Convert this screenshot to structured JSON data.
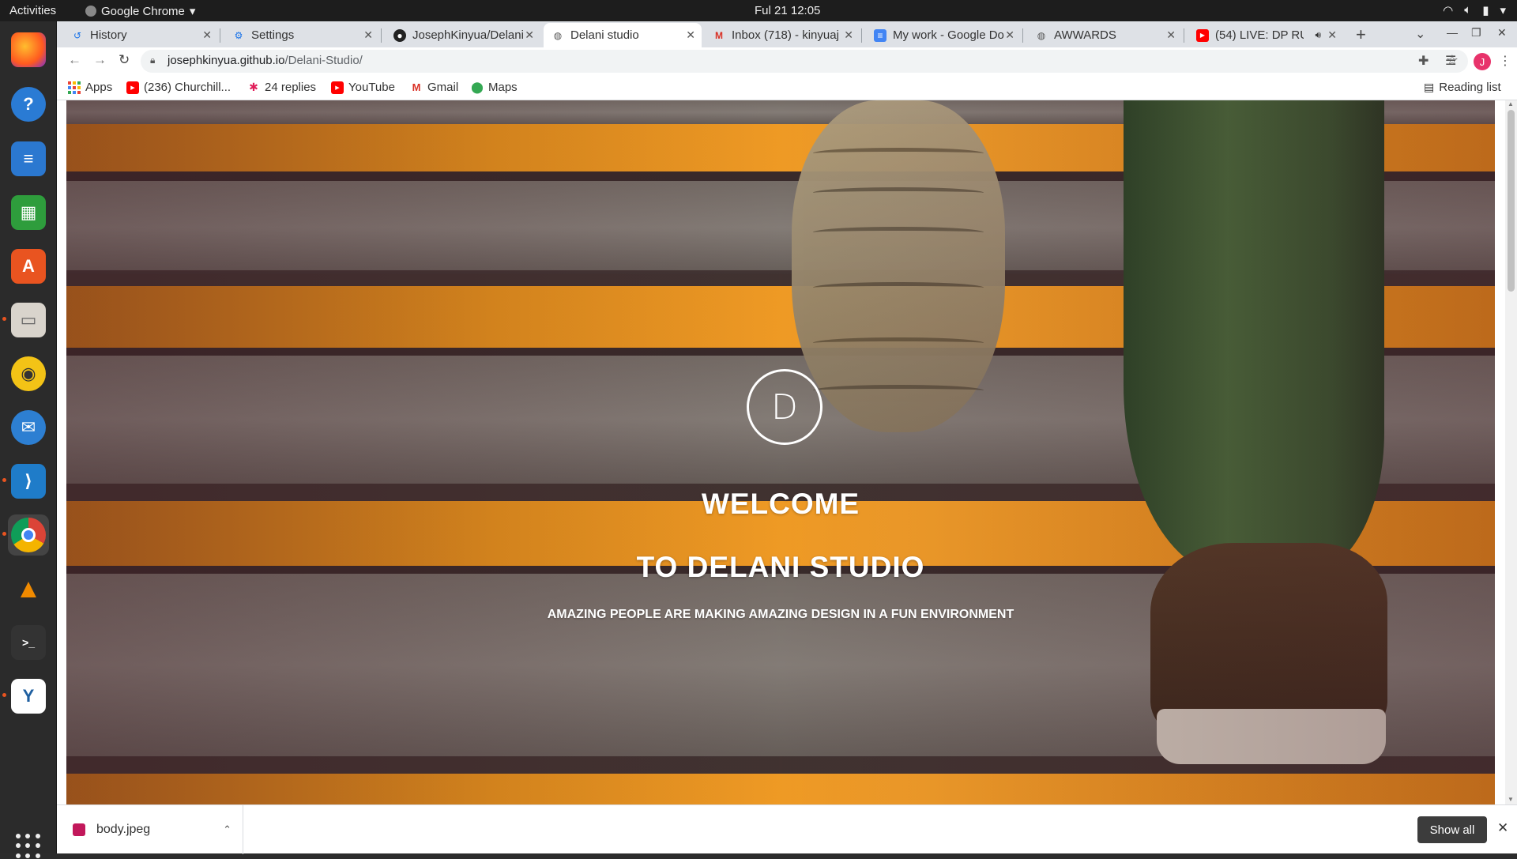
{
  "topbar": {
    "activities": "Activities",
    "app_name": "Google Chrome",
    "clock": "Ful 21  12:05"
  },
  "dock": {
    "items": [
      "Firefox",
      "Help",
      "LibreOffice Writer",
      "LibreOffice Calc",
      "Ubuntu Software",
      "Files",
      "Rhythmbox",
      "Thunderbird",
      "Visual Studio Code",
      "Google Chrome",
      "VLC",
      "Terminal",
      "Shotwell"
    ]
  },
  "tabs": [
    {
      "title": "History",
      "icon": "history-icon"
    },
    {
      "title": "Settings",
      "icon": "gear-icon"
    },
    {
      "title": "JosephKinyua/Delani",
      "icon": "github-icon"
    },
    {
      "title": "Delani studio",
      "icon": "globe-icon",
      "active": true
    },
    {
      "title": "Inbox (718) - kinyuaj",
      "icon": "gmail-icon"
    },
    {
      "title": "My work - Google Do",
      "icon": "docs-icon"
    },
    {
      "title": "AWWARDS",
      "icon": "globe-icon"
    },
    {
      "title": "(54) LIVE: DP RU",
      "icon": "youtube-icon"
    }
  ],
  "toolbar": {
    "url_host": "josephkinyua.github.io",
    "url_path": "/Delani-Studio/"
  },
  "bookmarks": [
    {
      "label": "Apps"
    },
    {
      "label": "(236) Churchill..."
    },
    {
      "label": "24 replies"
    },
    {
      "label": "YouTube"
    },
    {
      "label": "Gmail"
    },
    {
      "label": "Maps"
    }
  ],
  "reading_list": "Reading list",
  "avatar_letter": "J",
  "hero": {
    "logo_letter": "D",
    "title_line1": "WELCOME",
    "title_line2": "TO DELANI STUDIO",
    "subtitle": "AMAZING PEOPLE ARE MAKING AMAZING DESIGN IN A FUN ENVIRONMENT"
  },
  "downloads": {
    "file_name": "body.jpeg",
    "show_all": "Show all"
  },
  "colors": {
    "stair_orange": "#f39a1e",
    "avatar": "#e8336b",
    "dock_indicator": "#e95420"
  }
}
